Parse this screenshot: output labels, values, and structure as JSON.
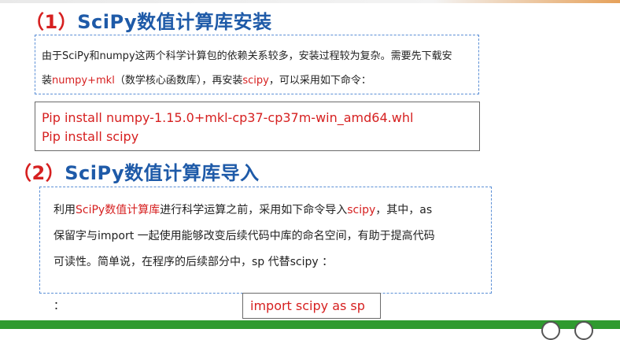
{
  "colors": {
    "heading_red": "#d62020",
    "heading_blue": "#1e5aa8",
    "accent_red": "#d62020",
    "dashed_border": "#5b8fd6",
    "bottom_bar": "#2f9a2f"
  },
  "section1": {
    "heading_num": "（1）",
    "heading_text": "SciPy数值计算库安装",
    "para_line1": "由于SciPy和numpy这两个科学计算包的依赖关系较多，安装过程较为复杂。需要先下载安",
    "para_line2_a": "装",
    "para_line2_red": "numpy+mkl",
    "para_line2_b": "（数学核心函数库），再安装",
    "para_line2_red2": "scipy",
    "para_line2_c": "，可以采用如下命令："
  },
  "commands": {
    "cmd1": "Pip install numpy-1.15.0+mkl-cp37-cp37m-win_amd64.whl",
    "cmd2": "Pip install scipy"
  },
  "section2": {
    "heading_num": "（2）",
    "heading_text": "SciPy数值计算库导入",
    "line1_a": "利用",
    "line1_red": "SciPy数值计算库",
    "line1_b": "进行科学运算之前，采用如下命令导入",
    "line1_red2": "scipy",
    "line1_c": "，其中，as",
    "line2": "保留字与import 一起使用能够改变后续代码中库的命名空间，有助于提高代码",
    "line3": "可读性。简单说，在程序的后续部分中，sp 代替scipy ：",
    "line4": "：",
    "import_cmd": "import scipy as sp"
  }
}
